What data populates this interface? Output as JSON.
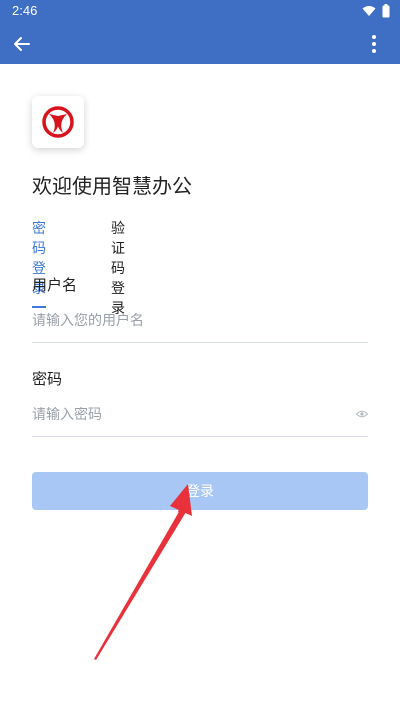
{
  "status_bar": {
    "time": "2:46"
  },
  "app_bar": {
    "back_icon": "arrow-left-icon",
    "menu_icon": "more-vert-icon"
  },
  "logo": {
    "brand_color": "#d7141d"
  },
  "welcome_text": "欢迎使用智慧办公",
  "tabs": [
    {
      "label": "密码登录",
      "active": true
    },
    {
      "label": "验证码登录",
      "active": false
    }
  ],
  "username": {
    "label": "用户名",
    "placeholder": "请输入您的用户名",
    "value": ""
  },
  "password": {
    "label": "密码",
    "placeholder": "请输入密码",
    "value": ""
  },
  "login_button": {
    "label": "登录"
  },
  "colors": {
    "header": "#3f6fc4",
    "accent": "#3f78d9",
    "button": "#a8c7f4",
    "annotation_arrow": "#e8313a"
  }
}
